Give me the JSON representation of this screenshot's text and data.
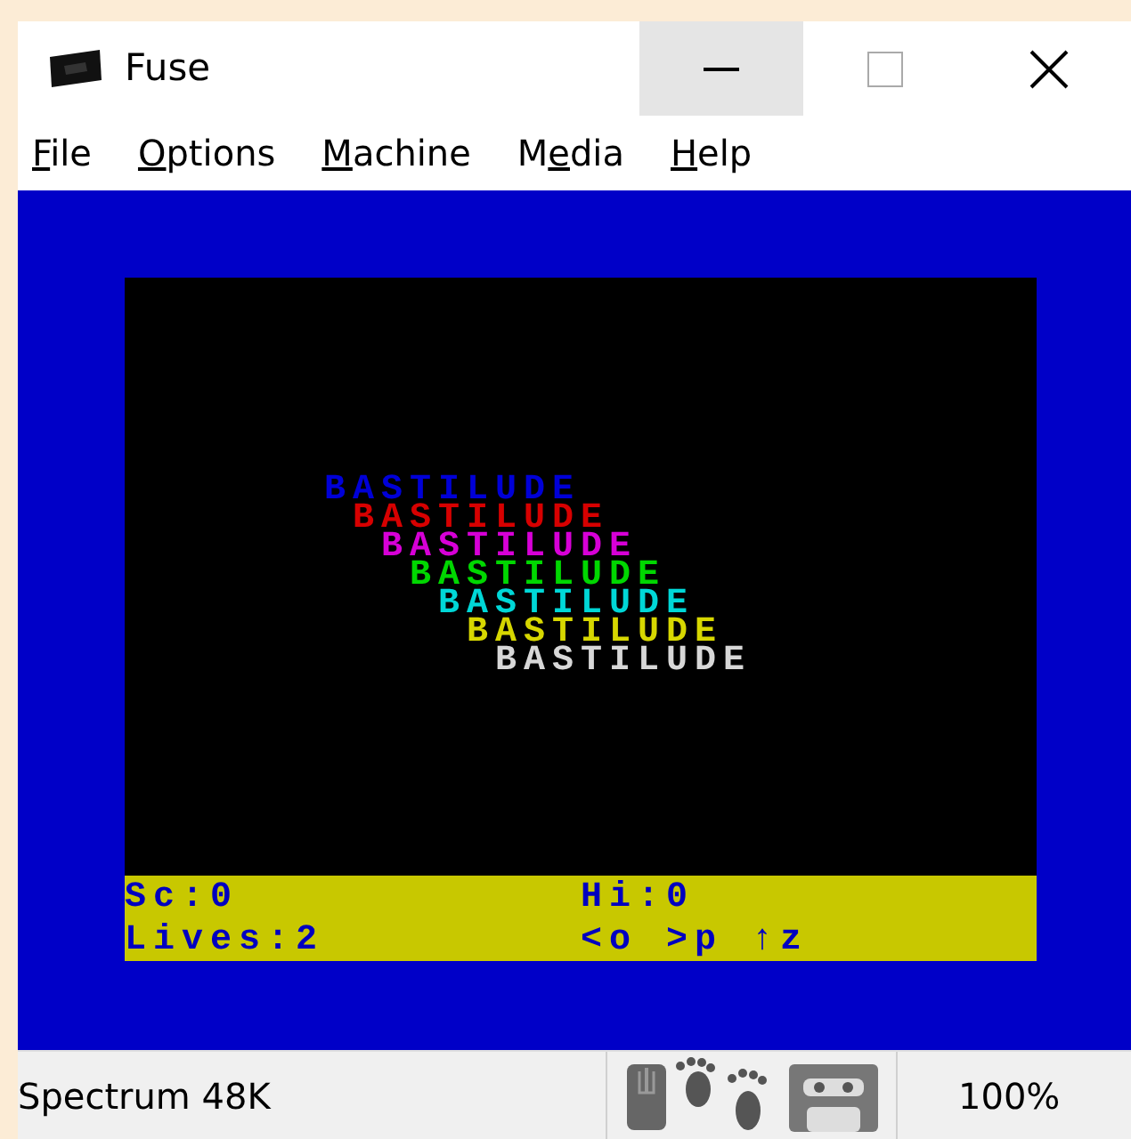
{
  "window": {
    "title": "Fuse",
    "controls": [
      {
        "kind": "minimize",
        "hovered": true
      },
      {
        "kind": "maximize",
        "hovered": false
      },
      {
        "kind": "close",
        "hovered": false
      }
    ]
  },
  "menu": [
    {
      "access_key": "F",
      "after": "ile"
    },
    {
      "access_key": "O",
      "after": "ptions"
    },
    {
      "access_key": "M",
      "after": "achine"
    },
    {
      "before": "M",
      "access_key": "e",
      "after": "dia"
    },
    {
      "access_key": "H",
      "after": "elp"
    }
  ],
  "screen": {
    "title_lines": [
      {
        "text": "BASTILUDE",
        "color": "#0000d7"
      },
      {
        "text": "BASTILUDE",
        "color": "#d70000"
      },
      {
        "text": "BASTILUDE",
        "color": "#d700d7"
      },
      {
        "text": "BASTILUDE",
        "color": "#00d700"
      },
      {
        "text": "BASTILUDE",
        "color": "#00d7d7"
      },
      {
        "text": "BASTILUDE",
        "color": "#d7d700"
      },
      {
        "text": "BASTILUDE",
        "color": "#d7d7d7"
      }
    ],
    "hud": {
      "score": "Sc:0",
      "hi_score": "Hi:0",
      "lives": "Lives:2",
      "keys": "<o >p ↑z"
    }
  },
  "status_bar": {
    "machine": "Spectrum 48K",
    "zoom": "100%"
  }
}
